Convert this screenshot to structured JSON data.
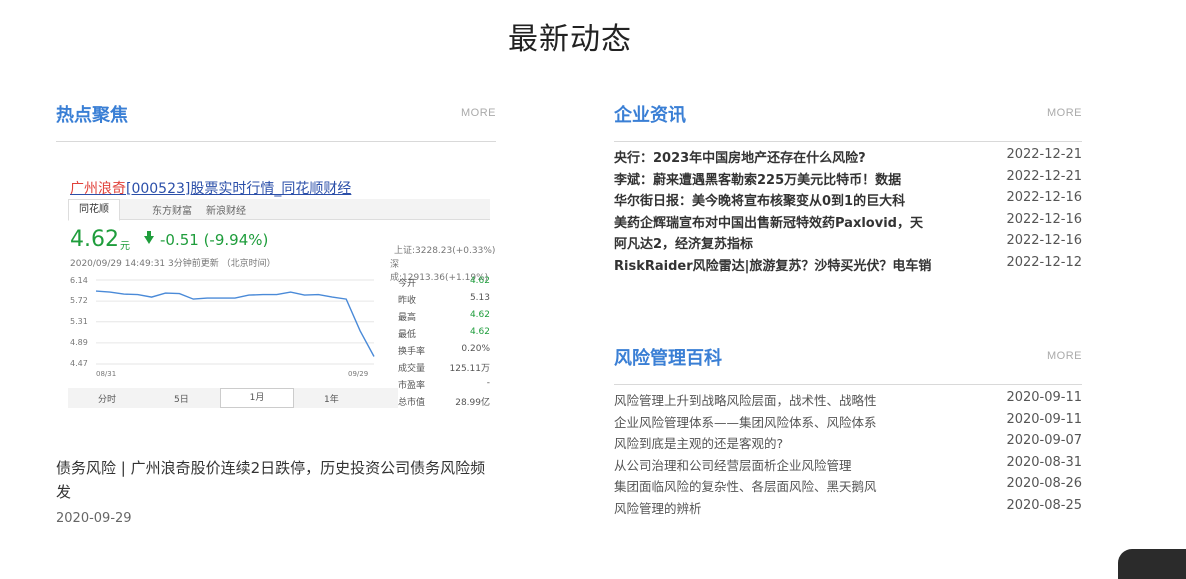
{
  "page_title": "最新动态",
  "hot": {
    "title": "热点聚焦",
    "more": "MORE",
    "image": {
      "link_prefix": "广州浪奇",
      "link_rest": "[000523]股票实时行情_同花顺财经",
      "tabs": [
        "同花顺",
        "东方财富",
        "新浪财经"
      ],
      "price": "4.62",
      "price_unit": "元",
      "change": "-0.51 (-9.94%)",
      "timeline": "2020/09/29 14:49:31  3分钟前更新 （北京时间）",
      "index_sh": "上证:3228.23(+0.33%)",
      "index_sz": "深成:12913.36(+1.19%)",
      "y_ticks": [
        "6.14",
        "5.72",
        "5.31",
        "4.89",
        "4.47"
      ],
      "x_start": "08/31",
      "x_end": "09/29",
      "stats": [
        {
          "k": "今开",
          "v": "4.62",
          "green": true
        },
        {
          "k": "昨收",
          "v": "5.13",
          "green": false
        },
        {
          "k": "最高",
          "v": "4.62",
          "green": true
        },
        {
          "k": "最低",
          "v": "4.62",
          "green": true
        },
        {
          "k": "换手率",
          "v": "0.20%",
          "green": false
        },
        {
          "k": "成交量",
          "v": "125.11万",
          "green": false
        },
        {
          "k": "市盈率",
          "v": "-",
          "green": false
        },
        {
          "k": "总市值",
          "v": "28.99亿",
          "green": false
        }
      ],
      "periods": [
        "分时",
        "5日",
        "1月",
        "1年"
      ],
      "series": [
        5.92,
        5.9,
        5.86,
        5.85,
        5.8,
        5.88,
        5.87,
        5.76,
        5.78,
        5.78,
        5.78,
        5.84,
        5.85,
        5.85,
        5.9,
        5.84,
        5.85,
        5.8,
        5.76,
        5.13,
        4.62
      ]
    },
    "caption": "债务风险 | 广州浪奇股价连续2日跌停，历史投资公司债务风险频发",
    "date": "2020-09-29"
  },
  "news": {
    "title": "企业资讯",
    "more": "MORE",
    "items": [
      {
        "title": "央行：2023年中国房地产还存在什么风险?",
        "date": "2022-12-21"
      },
      {
        "title": "李斌：蔚来遭遇黑客勒索225万美元比特币！数据",
        "date": "2022-12-21"
      },
      {
        "title": "华尔街日报：美今晚将宣布核聚变从0到1的巨大科",
        "date": "2022-12-16"
      },
      {
        "title": "美药企辉瑞宣布对中国出售新冠特效药Paxlovid，天",
        "date": "2022-12-16"
      },
      {
        "title": "阿凡达2，经济复苏指标",
        "date": "2022-12-16"
      },
      {
        "title": "RiskRaider风险雷达|旅游复苏？沙特买光伏？电车销",
        "date": "2022-12-12"
      }
    ]
  },
  "wiki": {
    "title": "风险管理百科",
    "more": "MORE",
    "items": [
      {
        "title": "风险管理上升到战略风险层面，战术性、战略性",
        "date": "2020-09-11"
      },
      {
        "title": "企业风险管理体系——集团风险体系、风险体系",
        "date": "2020-09-11"
      },
      {
        "title": "风险到底是主观的还是客观的?",
        "date": "2020-09-07"
      },
      {
        "title": "从公司治理和公司经营层面析企业风险管理",
        "date": "2020-08-31"
      },
      {
        "title": "集团面临风险的复杂性、各层面风险、黑天鹅风",
        "date": "2020-08-26"
      },
      {
        "title": "风险管理的辨析",
        "date": "2020-08-25"
      }
    ]
  }
}
